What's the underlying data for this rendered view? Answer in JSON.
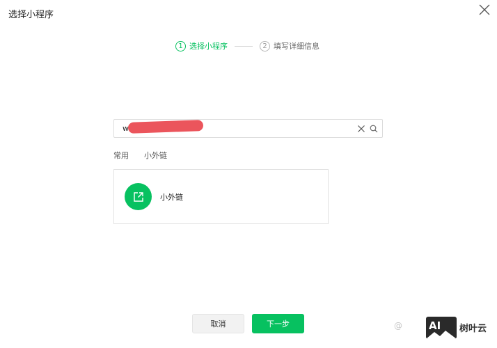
{
  "dialog": {
    "title": "选择小程序"
  },
  "stepper": {
    "steps": [
      {
        "num": "1",
        "label": "选择小程序"
      },
      {
        "num": "2",
        "label": "填写详细信息"
      }
    ]
  },
  "search": {
    "value": "w"
  },
  "tabs": [
    {
      "label": "常用"
    },
    {
      "label": "小外链"
    }
  ],
  "results": [
    {
      "name": "小外链",
      "icon": "external-link-icon"
    }
  ],
  "footer": {
    "cancel_label": "取消",
    "next_label": "下一步"
  },
  "watermark": {
    "left": "@",
    "logo": "AI",
    "text": "树叶云"
  },
  "colors": {
    "accent": "#07c160",
    "redaction": "#e9434a"
  }
}
